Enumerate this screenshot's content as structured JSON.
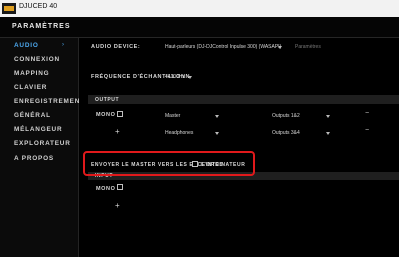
{
  "titlebar": {
    "title": "DJUCED 40"
  },
  "header": {
    "title": "PARAMÈTRES"
  },
  "sidebar": {
    "items": [
      {
        "label": "AUDIO"
      },
      {
        "label": "CONNEXION"
      },
      {
        "label": "MAPPING"
      },
      {
        "label": "CLAVIER"
      },
      {
        "label": "ENREGISTREMENT"
      },
      {
        "label": "GÉNÉRAL"
      },
      {
        "label": "MÉLANGEUR"
      },
      {
        "label": "EXPLORATEUR"
      },
      {
        "label": "A PROPOS"
      }
    ],
    "active_chevron": "›"
  },
  "audio": {
    "device_label": "AUDIO DEVICE:",
    "device_value": "Haut-parleurs (DJ-DJControl Inpulse 300) (WASAPI)",
    "device_extra": "Paramètres",
    "sample_rate_label": "FRÉQUENCE D'ÉCHANTILLONN",
    "sample_rate_value": "44100Hz",
    "output_section": "OUTPUT",
    "mono_label": "MONO",
    "rows": [
      {
        "source": "Master",
        "outputs": "Outputs 1&2",
        "remove": "−"
      },
      {
        "plus": "+",
        "source": "Headphones",
        "outputs": "Outputs 3&4",
        "remove": "−"
      }
    ],
    "master_send_label": "ENVOYER LE MASTER VERS LES ENCEINTES",
    "master_send_suffix": "L'ORDINATEUR",
    "input_section": "INPUT",
    "input_mono_label": "MONO",
    "input_plus": "+"
  },
  "colors": {
    "accent": "#4da9f0",
    "highlight": "#e0191b"
  }
}
